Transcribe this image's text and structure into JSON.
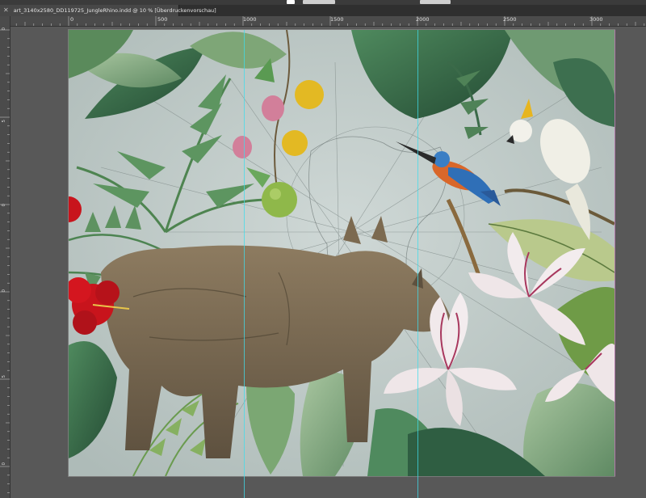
{
  "document": {
    "tab_title": "art_3140x2580_DD119725_JungleRhino.indd @ 10 % [Überdruckenvorschau]",
    "close_icon": "close-icon"
  },
  "ruler": {
    "horizontal_labels": [
      "0",
      "500",
      "1000",
      "1500",
      "2000",
      "2500",
      "3000"
    ],
    "vertical_labels": [
      "0",
      "5",
      "0",
      "0",
      "5",
      "0",
      "0"
    ]
  },
  "artwork": {
    "subject_icons": [
      "rhino-illustration",
      "kingfisher-bird",
      "cockatoo-bird",
      "lily-flowers",
      "hibiscus-flower",
      "fruit-branch",
      "jungle-leaves"
    ],
    "colors": {
      "background": "#c2cccb",
      "leaf_dark": "#3c6b4a",
      "leaf_light": "#8fb08a",
      "rhino": "#7a6a52",
      "hibiscus": "#c8141c",
      "lily": "#f0e8ea",
      "guide": "#40dceb"
    }
  }
}
